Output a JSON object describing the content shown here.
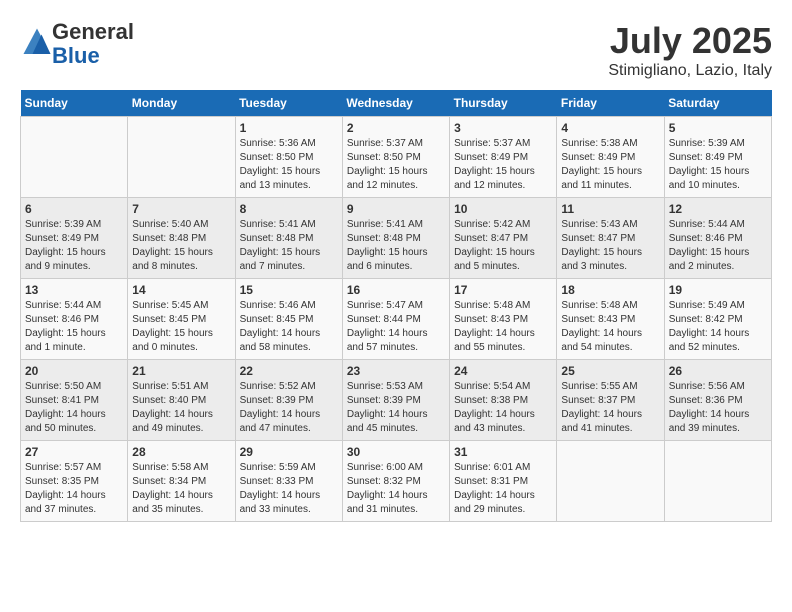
{
  "header": {
    "logo_line1": "General",
    "logo_line2": "Blue",
    "month": "July 2025",
    "location": "Stimigliano, Lazio, Italy"
  },
  "weekdays": [
    "Sunday",
    "Monday",
    "Tuesday",
    "Wednesday",
    "Thursday",
    "Friday",
    "Saturday"
  ],
  "weeks": [
    [
      {
        "day": "",
        "info": ""
      },
      {
        "day": "",
        "info": ""
      },
      {
        "day": "1",
        "info": "Sunrise: 5:36 AM\nSunset: 8:50 PM\nDaylight: 15 hours and 13 minutes."
      },
      {
        "day": "2",
        "info": "Sunrise: 5:37 AM\nSunset: 8:50 PM\nDaylight: 15 hours and 12 minutes."
      },
      {
        "day": "3",
        "info": "Sunrise: 5:37 AM\nSunset: 8:49 PM\nDaylight: 15 hours and 12 minutes."
      },
      {
        "day": "4",
        "info": "Sunrise: 5:38 AM\nSunset: 8:49 PM\nDaylight: 15 hours and 11 minutes."
      },
      {
        "day": "5",
        "info": "Sunrise: 5:39 AM\nSunset: 8:49 PM\nDaylight: 15 hours and 10 minutes."
      }
    ],
    [
      {
        "day": "6",
        "info": "Sunrise: 5:39 AM\nSunset: 8:49 PM\nDaylight: 15 hours and 9 minutes."
      },
      {
        "day": "7",
        "info": "Sunrise: 5:40 AM\nSunset: 8:48 PM\nDaylight: 15 hours and 8 minutes."
      },
      {
        "day": "8",
        "info": "Sunrise: 5:41 AM\nSunset: 8:48 PM\nDaylight: 15 hours and 7 minutes."
      },
      {
        "day": "9",
        "info": "Sunrise: 5:41 AM\nSunset: 8:48 PM\nDaylight: 15 hours and 6 minutes."
      },
      {
        "day": "10",
        "info": "Sunrise: 5:42 AM\nSunset: 8:47 PM\nDaylight: 15 hours and 5 minutes."
      },
      {
        "day": "11",
        "info": "Sunrise: 5:43 AM\nSunset: 8:47 PM\nDaylight: 15 hours and 3 minutes."
      },
      {
        "day": "12",
        "info": "Sunrise: 5:44 AM\nSunset: 8:46 PM\nDaylight: 15 hours and 2 minutes."
      }
    ],
    [
      {
        "day": "13",
        "info": "Sunrise: 5:44 AM\nSunset: 8:46 PM\nDaylight: 15 hours and 1 minute."
      },
      {
        "day": "14",
        "info": "Sunrise: 5:45 AM\nSunset: 8:45 PM\nDaylight: 15 hours and 0 minutes."
      },
      {
        "day": "15",
        "info": "Sunrise: 5:46 AM\nSunset: 8:45 PM\nDaylight: 14 hours and 58 minutes."
      },
      {
        "day": "16",
        "info": "Sunrise: 5:47 AM\nSunset: 8:44 PM\nDaylight: 14 hours and 57 minutes."
      },
      {
        "day": "17",
        "info": "Sunrise: 5:48 AM\nSunset: 8:43 PM\nDaylight: 14 hours and 55 minutes."
      },
      {
        "day": "18",
        "info": "Sunrise: 5:48 AM\nSunset: 8:43 PM\nDaylight: 14 hours and 54 minutes."
      },
      {
        "day": "19",
        "info": "Sunrise: 5:49 AM\nSunset: 8:42 PM\nDaylight: 14 hours and 52 minutes."
      }
    ],
    [
      {
        "day": "20",
        "info": "Sunrise: 5:50 AM\nSunset: 8:41 PM\nDaylight: 14 hours and 50 minutes."
      },
      {
        "day": "21",
        "info": "Sunrise: 5:51 AM\nSunset: 8:40 PM\nDaylight: 14 hours and 49 minutes."
      },
      {
        "day": "22",
        "info": "Sunrise: 5:52 AM\nSunset: 8:39 PM\nDaylight: 14 hours and 47 minutes."
      },
      {
        "day": "23",
        "info": "Sunrise: 5:53 AM\nSunset: 8:39 PM\nDaylight: 14 hours and 45 minutes."
      },
      {
        "day": "24",
        "info": "Sunrise: 5:54 AM\nSunset: 8:38 PM\nDaylight: 14 hours and 43 minutes."
      },
      {
        "day": "25",
        "info": "Sunrise: 5:55 AM\nSunset: 8:37 PM\nDaylight: 14 hours and 41 minutes."
      },
      {
        "day": "26",
        "info": "Sunrise: 5:56 AM\nSunset: 8:36 PM\nDaylight: 14 hours and 39 minutes."
      }
    ],
    [
      {
        "day": "27",
        "info": "Sunrise: 5:57 AM\nSunset: 8:35 PM\nDaylight: 14 hours and 37 minutes."
      },
      {
        "day": "28",
        "info": "Sunrise: 5:58 AM\nSunset: 8:34 PM\nDaylight: 14 hours and 35 minutes."
      },
      {
        "day": "29",
        "info": "Sunrise: 5:59 AM\nSunset: 8:33 PM\nDaylight: 14 hours and 33 minutes."
      },
      {
        "day": "30",
        "info": "Sunrise: 6:00 AM\nSunset: 8:32 PM\nDaylight: 14 hours and 31 minutes."
      },
      {
        "day": "31",
        "info": "Sunrise: 6:01 AM\nSunset: 8:31 PM\nDaylight: 14 hours and 29 minutes."
      },
      {
        "day": "",
        "info": ""
      },
      {
        "day": "",
        "info": ""
      }
    ]
  ]
}
